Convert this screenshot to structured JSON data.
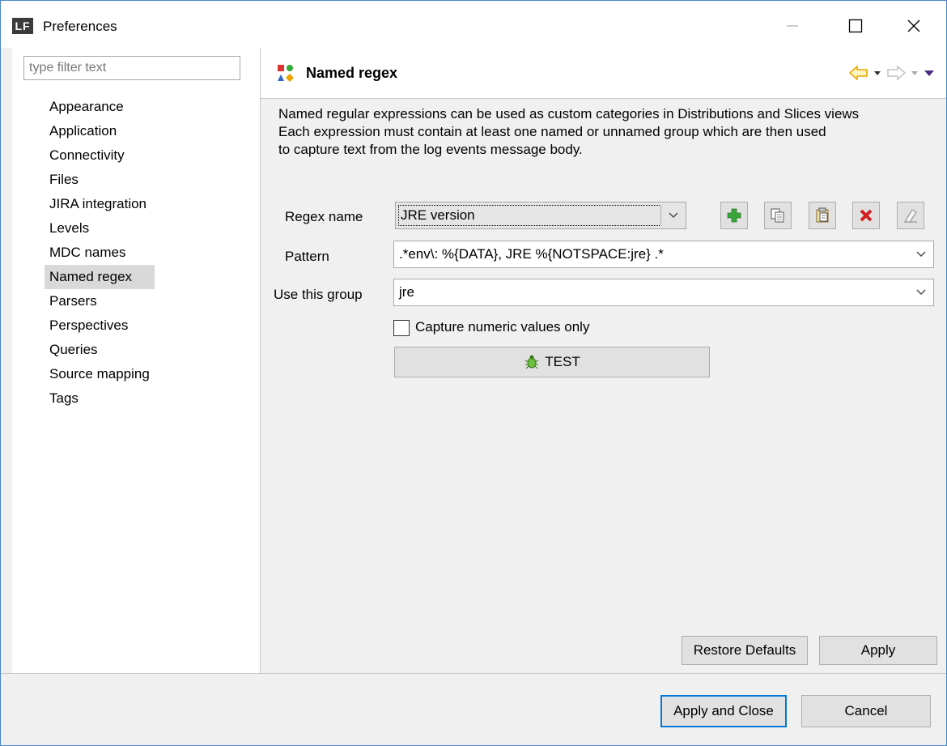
{
  "window": {
    "app_icon_text": "LF",
    "title": "Preferences",
    "minimize_symbol": "—",
    "maximize_symbol": "☐",
    "close_symbol": "✕"
  },
  "sidebar": {
    "filter_placeholder": "type filter text",
    "items": [
      {
        "label": "Appearance"
      },
      {
        "label": "Application"
      },
      {
        "label": "Connectivity"
      },
      {
        "label": "Files"
      },
      {
        "label": "JIRA integration"
      },
      {
        "label": "Levels"
      },
      {
        "label": "MDC names"
      },
      {
        "label": "Named regex",
        "selected": true
      },
      {
        "label": "Parsers"
      },
      {
        "label": "Perspectives"
      },
      {
        "label": "Queries"
      },
      {
        "label": "Source mapping"
      },
      {
        "label": "Tags"
      }
    ]
  },
  "page": {
    "title": "Named regex",
    "description": [
      "Named regular expressions can be used as custom categories in Distributions and Slices views",
      "Each expression must contain at least one named or unnamed group which are then used",
      "to capture text from the log events message body."
    ]
  },
  "form": {
    "regex_name_label": "Regex name",
    "regex_name_value": "JRE version",
    "pattern_label": "Pattern",
    "pattern_value": ".*env\\: %{DATA}, JRE %{NOTSPACE:jre} .*",
    "group_label": "Use this group",
    "group_value": "jre",
    "numeric_label": "Capture numeric values only",
    "numeric_checked": false,
    "test_label": "TEST"
  },
  "buttons": {
    "restore_defaults": "Restore Defaults",
    "apply": "Apply",
    "apply_and_close": "Apply and Close",
    "cancel": "Cancel"
  },
  "icons": {
    "add": "add-icon",
    "copy": "copy-icon",
    "paste": "paste-icon",
    "delete": "delete-icon",
    "clear": "eraser-icon",
    "test": "bug-icon",
    "back": "back-arrow-icon",
    "forward": "forward-arrow-icon",
    "menu": "view-menu-icon"
  },
  "colors": {
    "selection": "#d9d9d9",
    "focus_border": "#0078d7",
    "add_green": "#3aa63a",
    "delete_red": "#d02020",
    "back_arrow": "#e8a800"
  }
}
